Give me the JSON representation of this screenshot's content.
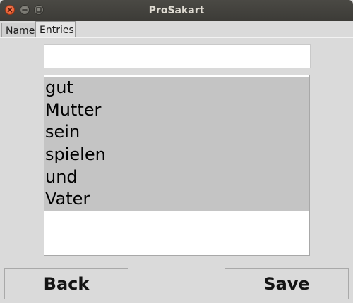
{
  "window": {
    "title": "ProSakart"
  },
  "tabs": [
    {
      "label": "Name"
    },
    {
      "label": "Entries"
    }
  ],
  "entry": {
    "value": "",
    "placeholder": ""
  },
  "list": {
    "items": [
      "gut",
      "Mutter",
      "sein",
      "spielen",
      "und",
      "Vater"
    ]
  },
  "buttons": {
    "back_label": "Back",
    "save_label": "Save"
  },
  "colors": {
    "titlebar": "#3c3b37",
    "close_button": "#e3501c",
    "window_bg": "#dadada",
    "selection_bg": "#c4c4c4"
  }
}
